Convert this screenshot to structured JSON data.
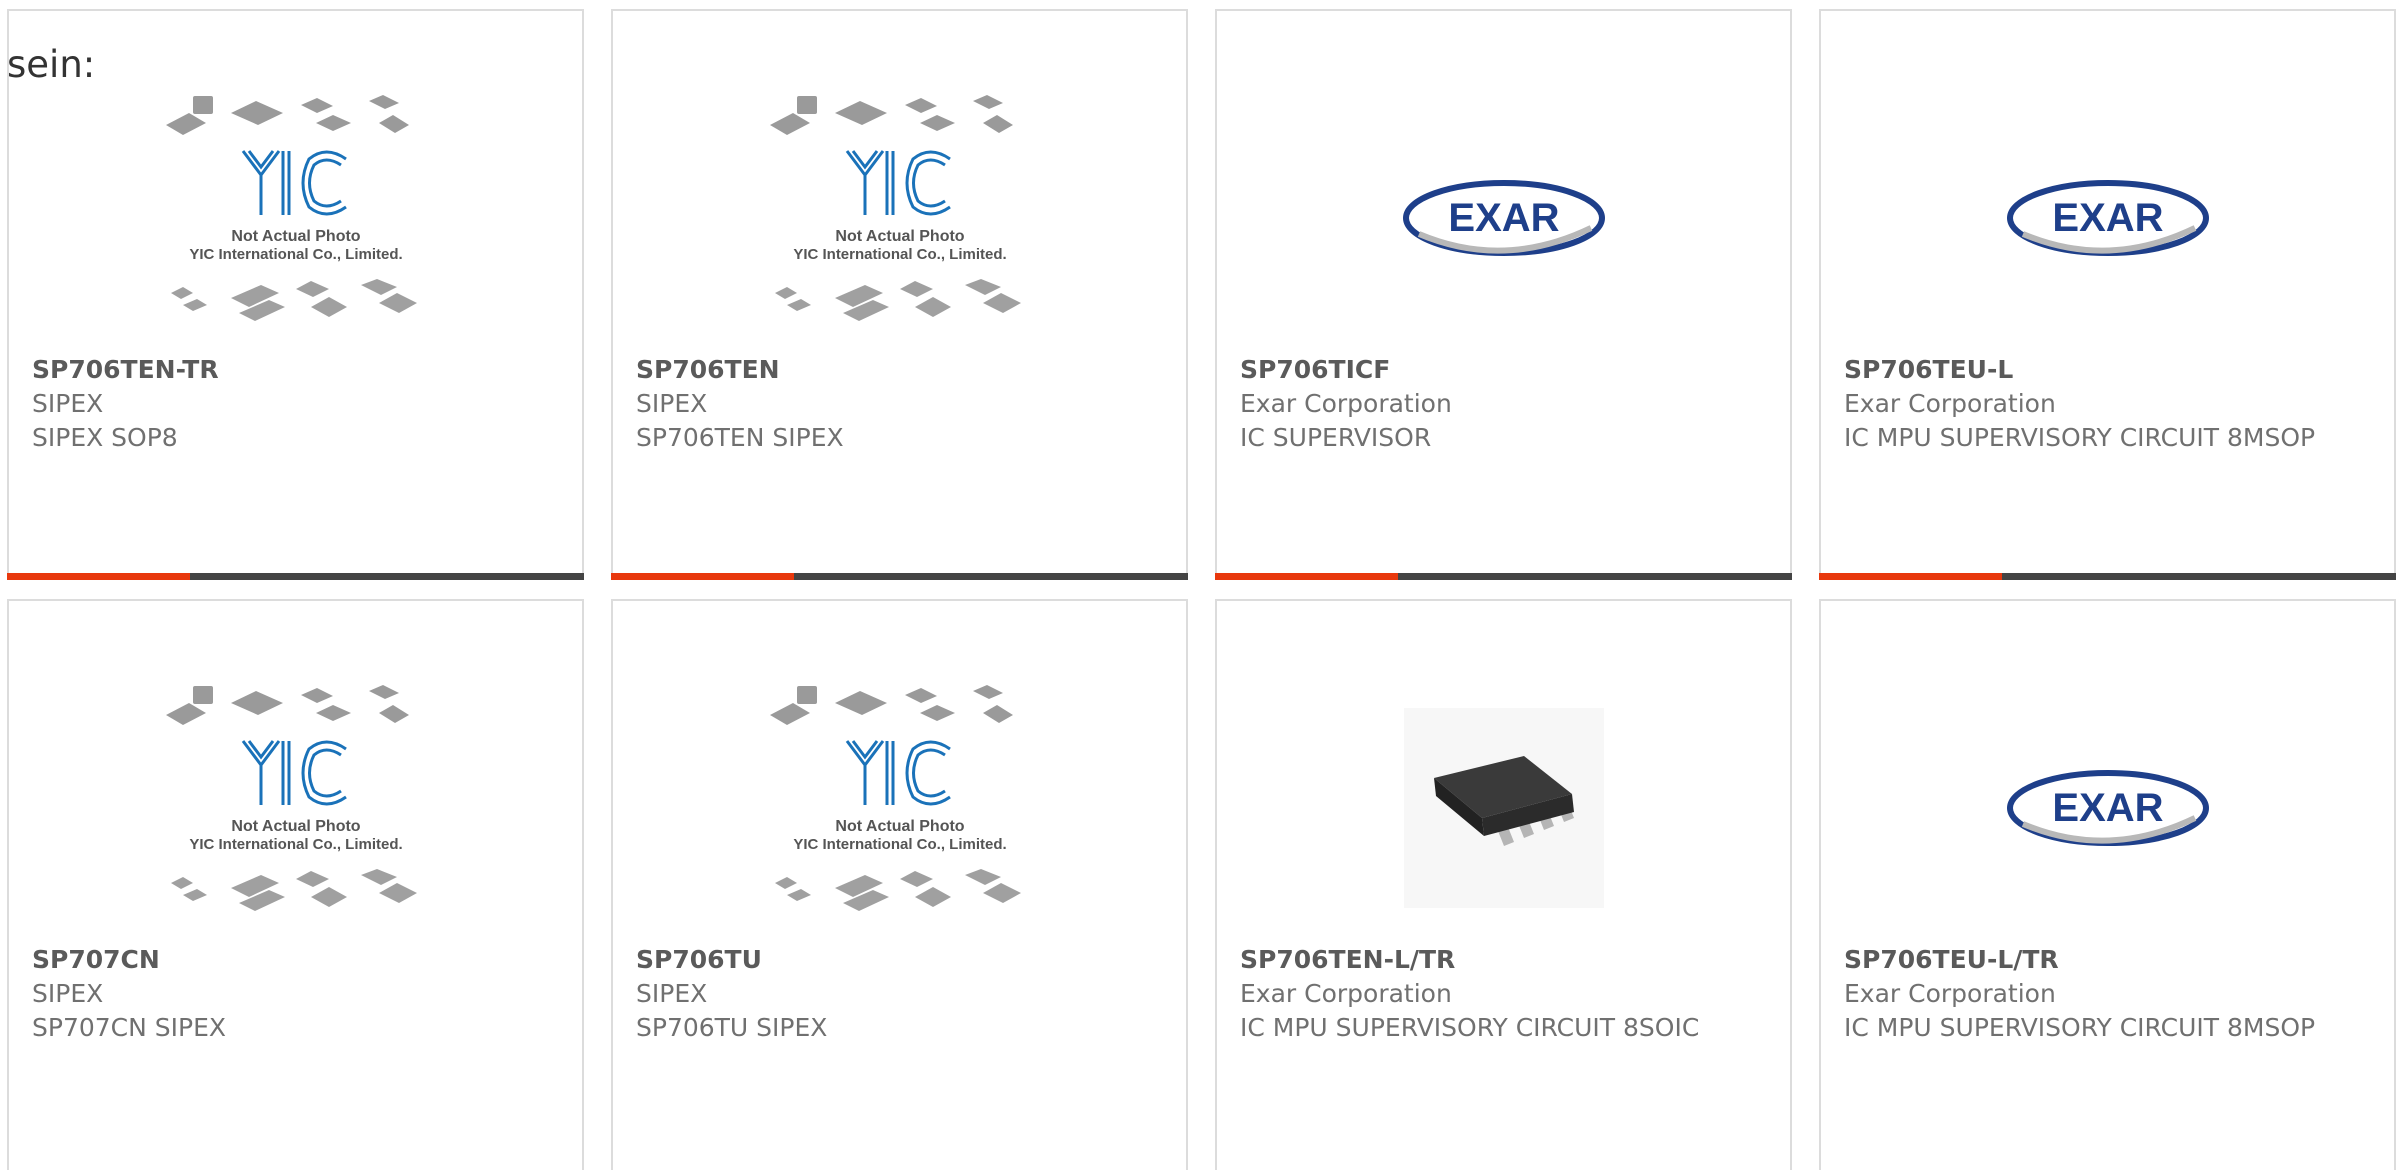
{
  "lead_text": "sein:",
  "colors": {
    "accent": "#e8380d",
    "bar": "#444444",
    "yic_blue": "#1a72b9",
    "exar_blue": "#1e3f8a"
  },
  "placeholder": {
    "line1": "Not Actual Photo",
    "line2": "YIC International Co., Limited.",
    "logo_text": "YIC"
  },
  "exar_logo_text": "EXAR",
  "products": [
    {
      "part": "SP706TEN-TR",
      "maker": "SIPEX",
      "desc": "SIPEX SOP8",
      "image": "yic-placeholder"
    },
    {
      "part": "SP706TEN",
      "maker": "SIPEX",
      "desc": "SP706TEN SIPEX",
      "image": "yic-placeholder"
    },
    {
      "part": "SP706TICF",
      "maker": "Exar Corporation",
      "desc": "IC SUPERVISOR",
      "image": "exar-logo"
    },
    {
      "part": "SP706TEU-L",
      "maker": "Exar Corporation",
      "desc": "IC MPU SUPERVISORY CIRCUIT 8MSOP",
      "image": "exar-logo"
    },
    {
      "part": "SP707CN",
      "maker": "SIPEX",
      "desc": "SP707CN SIPEX",
      "image": "yic-placeholder"
    },
    {
      "part": "SP706TU",
      "maker": "SIPEX",
      "desc": "SP706TU SIPEX",
      "image": "yic-placeholder"
    },
    {
      "part": "SP706TEN-L/TR",
      "maker": "Exar Corporation",
      "desc": "IC MPU SUPERVISORY CIRCUIT 8SOIC",
      "image": "soic-chip-photo"
    },
    {
      "part": "SP706TEU-L/TR",
      "maker": "Exar Corporation",
      "desc": "IC MPU SUPERVISORY CIRCUIT 8MSOP",
      "image": "exar-logo"
    }
  ]
}
